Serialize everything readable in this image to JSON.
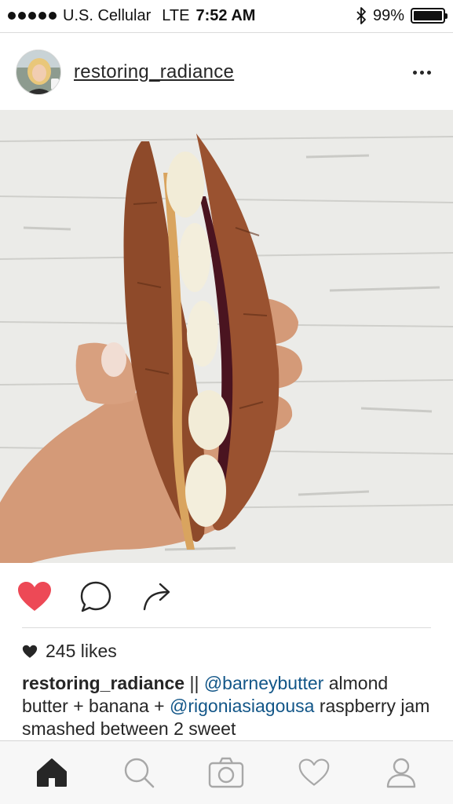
{
  "status_bar": {
    "carrier": "U.S. Cellular",
    "network": "LTE",
    "time": "7:52 AM",
    "battery_percent": "99%",
    "battery_level": 0.99,
    "icons": [
      "signal-dots-icon",
      "bluetooth-icon",
      "battery-icon"
    ]
  },
  "post": {
    "username": "restoring_radiance",
    "avatar_icon": "avatar",
    "more_icon": "more-options-icon",
    "photo_icon": "post-photo",
    "actions": {
      "like_icon": "heart-filled-icon",
      "comment_icon": "comment-bubble-icon",
      "share_icon": "share-arrow-icon",
      "like_color": "#ed4956"
    },
    "likes_text": "245 likes",
    "caption": {
      "username": "restoring_radiance",
      "separator": " || ",
      "mention1": "@barneybutter",
      "text1": " almond butter + banana + ",
      "mention2": "@rigoniasiagousa",
      "text2": " raspberry jam smashed between 2 sweet"
    }
  },
  "tab_bar": {
    "items": [
      {
        "icon": "home-icon",
        "active": true
      },
      {
        "icon": "search-icon",
        "active": false
      },
      {
        "icon": "camera-icon",
        "active": false
      },
      {
        "icon": "heart-outline-icon",
        "active": false
      },
      {
        "icon": "profile-icon",
        "active": false
      }
    ]
  },
  "colors": {
    "text": "#262626",
    "mention": "#125688",
    "like": "#ed4956",
    "inactive_icon": "#a8a8a8"
  }
}
